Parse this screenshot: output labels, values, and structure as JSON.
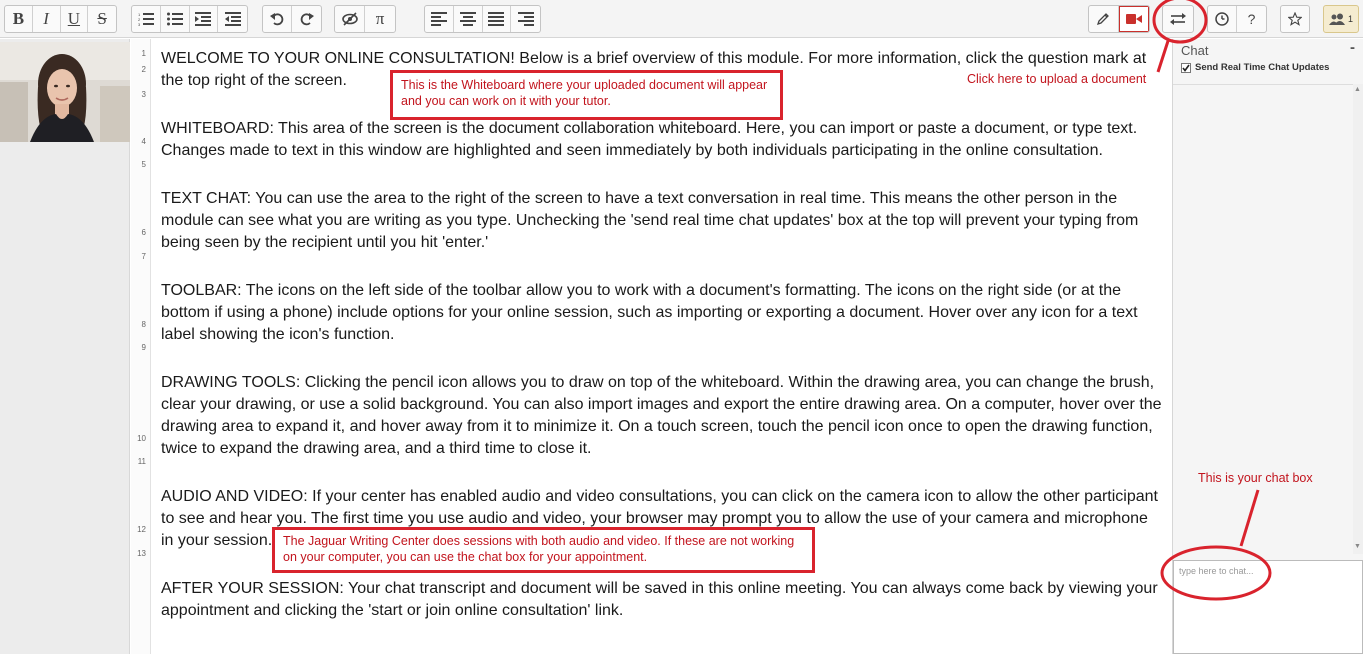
{
  "toolbar": {
    "format_buttons": [
      {
        "label": "B",
        "icon": "bold-icon"
      },
      {
        "label": "I",
        "icon": "italic-icon"
      },
      {
        "label": "U",
        "icon": "underline-icon"
      },
      {
        "label": "S",
        "icon": "strikethrough-icon"
      }
    ],
    "list_buttons": [
      "ordered-list-icon",
      "unordered-list-icon",
      "indent-icon",
      "outdent-icon"
    ],
    "history_buttons": [
      "undo-icon",
      "redo-icon"
    ],
    "insert_buttons": [
      {
        "icon": "clear-format-icon"
      },
      {
        "label": "π",
        "icon": "pi-icon"
      }
    ],
    "align_buttons": [
      "align-left-icon",
      "align-center-icon",
      "align-justify-icon",
      "align-right-icon"
    ],
    "right_buttons": [
      "pencil-icon",
      "video-camera-icon",
      "import-export-icon",
      "clock-icon",
      "help-icon",
      "star-icon",
      "users-icon"
    ],
    "help_label": "?",
    "users_count": "1",
    "accent_color": "#c9302c"
  },
  "gutter": {
    "line_numbers": [
      "1",
      "2",
      "3",
      "4",
      "5",
      "6",
      "7",
      "8",
      "9",
      "10",
      "11",
      "12",
      "13"
    ]
  },
  "editor": {
    "paragraphs": [
      "WELCOME TO YOUR ONLINE CONSULTATION! Below is a brief overview of this module. For more information, click the question mark at the top right of the screen.",
      "WHITEBOARD: This area of the screen is the document collaboration whiteboard. Here, you can import or paste a document, or type text. Changes made to text in this window are highlighted and seen immediately by both individuals participating in the online consultation.",
      "TEXT CHAT: You can use the area to the right of the screen to have a text conversation in real time. This means the other person in the module can see what you are writing as you type. Unchecking the 'send real time chat updates' box at the top will prevent your typing from being seen by the recipient until you hit 'enter.'",
      "TOOLBAR: The icons on the left side of the toolbar allow you to work with a document's formatting. The icons on the right side (or at the bottom if using a phone) include options for your online session, such as importing or exporting a document. Hover over any icon for a text label showing the icon's function.",
      "DRAWING TOOLS: Clicking the pencil icon allows you to draw on top of the whiteboard. Within the drawing area, you can change the brush, clear your drawing, or use a solid background. You can also import images and export the entire drawing area. On a computer, hover over the drawing area to expand it, and hover away from it to minimize it. On a touch screen, touch the pencil icon once to open the drawing function, twice to expand the drawing area, and a third time to close it.",
      "AUDIO AND VIDEO: If your center has enabled audio and video consultations, you can click on the camera icon to allow the other participant to see and hear you. The first time you use audio and video, your browser may prompt you to allow the use of your camera and microphone in your session.",
      "AFTER YOUR SESSION: Your chat transcript and document will be saved in this online meeting. You can always come back by viewing your appointment and clicking the 'start or join online consultation' link."
    ]
  },
  "chat": {
    "title": "Chat",
    "minimize": "-",
    "send_realtime_label": "Send Real Time Chat Updates",
    "send_realtime_checked": true,
    "input_placeholder": "type here to chat..."
  },
  "annotations": {
    "whiteboard_note": "This is the Whiteboard where your uploaded document will appear and you can work on it with your tutor.",
    "upload_note": "Click here to upload a document",
    "chatbox_note": "This is your chat box",
    "av_note": "The Jaguar Writing Center does sessions with both audio and video. If these are not working on your computer, you can use the chat box for your appointment.",
    "annotation_color": "#d9232d"
  }
}
